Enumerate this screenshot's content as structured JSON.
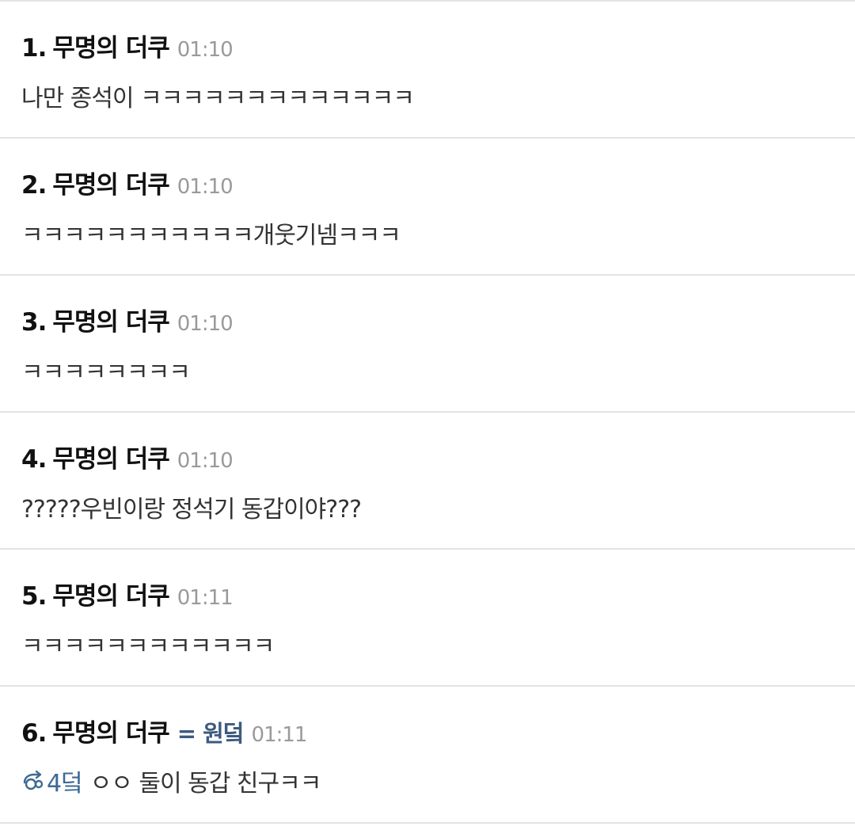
{
  "comments": [
    {
      "number": "1.",
      "author": "무명의 더쿠",
      "anchor": "",
      "time": "01:10",
      "reply_ref": "",
      "text": "나만 종석이 ㅋㅋㅋㅋㅋㅋㅋㅋㅋㅋㅋㅋㅋ"
    },
    {
      "number": "2.",
      "author": "무명의 더쿠",
      "anchor": "",
      "time": "01:10",
      "reply_ref": "",
      "text": "ㅋㅋㅋㅋㅋㅋㅋㅋㅋㅋㅋ개웃기넴ㅋㅋㅋ"
    },
    {
      "number": "3.",
      "author": "무명의 더쿠",
      "anchor": "",
      "time": "01:10",
      "reply_ref": "",
      "text": "ㅋㅋㅋㅋㅋㅋㅋㅋ"
    },
    {
      "number": "4.",
      "author": "무명의 더쿠",
      "anchor": "",
      "time": "01:10",
      "reply_ref": "",
      "text": "?????우빈이랑 정석기 동갑이야???"
    },
    {
      "number": "5.",
      "author": "무명의 더쿠",
      "anchor": "",
      "time": "01:11",
      "reply_ref": "",
      "text": "ㅋㅋㅋㅋㅋㅋㅋㅋㅋㅋㅋㅋ"
    },
    {
      "number": "6.",
      "author": "무명의 더쿠",
      "anchor": "= 원덬",
      "time": "01:11",
      "reply_ref": "4덬",
      "text": "ㅇㅇ 둘이 동갑 친구ㅋㅋ"
    }
  ],
  "colors": {
    "anchor": "#3d5a80",
    "time": "#9a9a9a",
    "divider": "#e3e3e3",
    "reply_ref": "#3d6a94"
  },
  "icons": {
    "reply": "reply-arrow-icon"
  }
}
